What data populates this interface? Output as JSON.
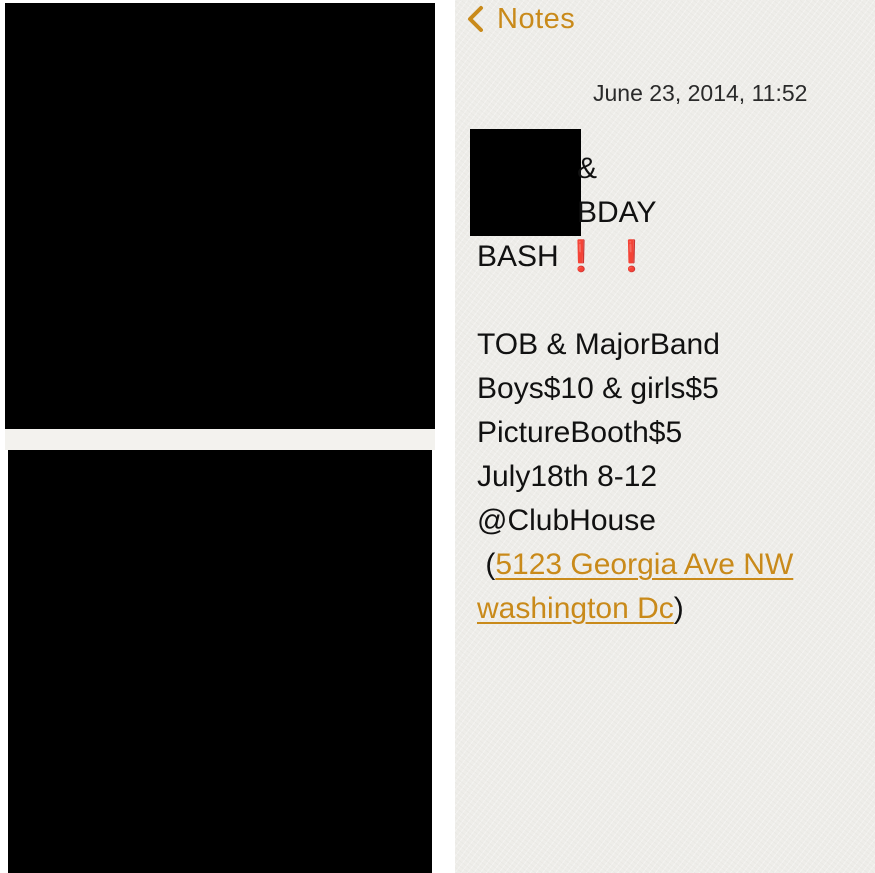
{
  "nav": {
    "back_label": "Notes",
    "back_icon": "chevron-left-icon",
    "accent_color": "#c98a1a"
  },
  "note": {
    "date": "June 23, 2014, 11:52",
    "title_lines": [
      "&",
      "BDAY",
      "BASH"
    ],
    "emphasis_icon": "double-exclamation-icon",
    "emphasis_glyphs": "❗ ❗",
    "details": [
      "TOB & MajorBand",
      "Boys$10 & girls$5",
      "PictureBooth$5",
      "July18th 8-12",
      "@ClubHouse"
    ],
    "address_prefix": " (",
    "address_line1": "5123 Georgia Ave NW",
    "address_line2": "washington Dc",
    "address_suffix": ")",
    "link_color": "#c98a1a",
    "emphasis_color": "#d11a1a"
  }
}
